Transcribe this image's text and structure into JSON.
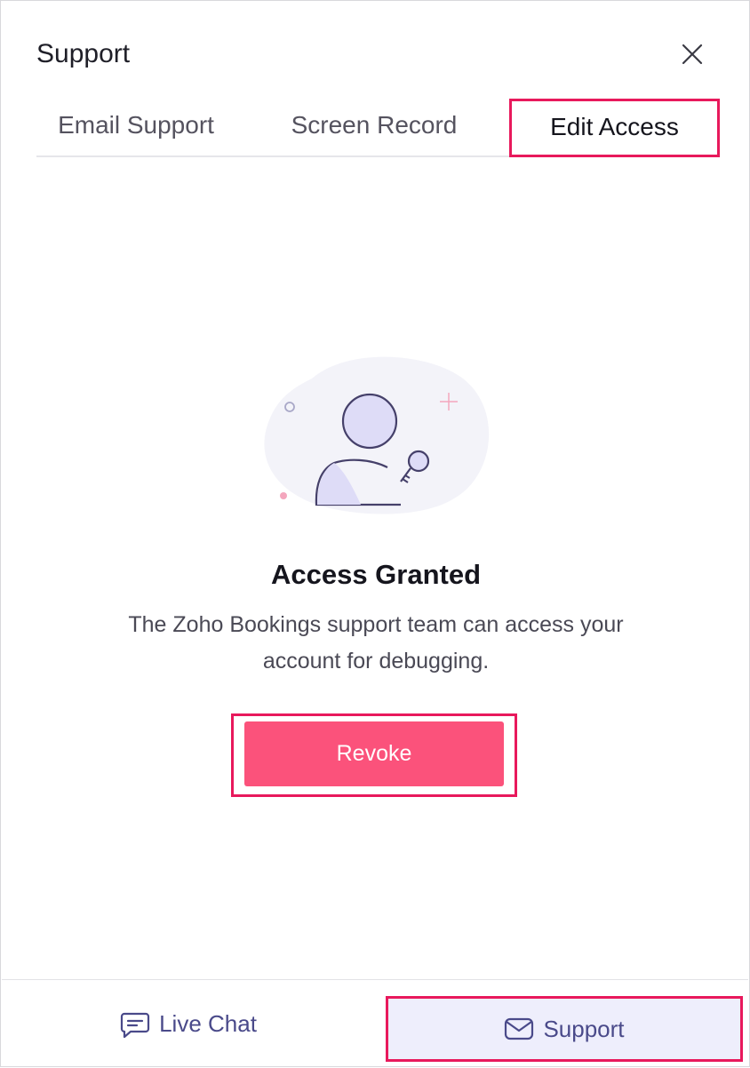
{
  "header": {
    "title": "Support",
    "close_icon": "close-icon"
  },
  "tabs": [
    {
      "label": "Email Support",
      "active": false
    },
    {
      "label": "Screen Record",
      "active": false
    },
    {
      "label": "Edit Access",
      "active": true
    }
  ],
  "status": {
    "title": "Access Granted",
    "description": "The Zoho Bookings support team can access your account for debugging.",
    "illustration_icon": "user-key-icon"
  },
  "actions": {
    "revoke_label": "Revoke"
  },
  "footer": {
    "live_chat_label": "Live Chat",
    "live_chat_icon": "chat-icon",
    "support_label": "Support",
    "support_icon": "mail-icon"
  },
  "colors": {
    "accent_pink": "#fb527b",
    "highlight_red": "#e8195c",
    "footer_active_bg": "#eeeefc",
    "footer_text": "#4a4a8a"
  }
}
